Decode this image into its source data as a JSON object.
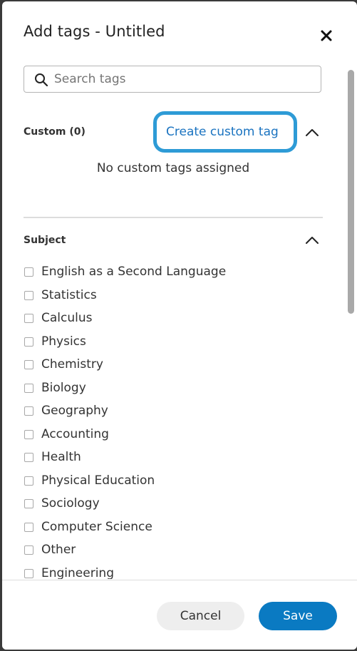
{
  "dialog": {
    "title": "Add tags - Untitled",
    "close_icon": "close-icon"
  },
  "search": {
    "placeholder": "Search tags",
    "value": ""
  },
  "custom": {
    "title": "Custom (0)",
    "create_label": "Create custom tag",
    "empty_text": "No custom tags assigned",
    "expanded": true
  },
  "subject": {
    "title": "Subject",
    "expanded": true,
    "items": [
      {
        "label": "English as a Second Language",
        "checked": false
      },
      {
        "label": "Statistics",
        "checked": false
      },
      {
        "label": "Calculus",
        "checked": false
      },
      {
        "label": "Physics",
        "checked": false
      },
      {
        "label": "Chemistry",
        "checked": false
      },
      {
        "label": "Biology",
        "checked": false
      },
      {
        "label": "Geography",
        "checked": false
      },
      {
        "label": "Accounting",
        "checked": false
      },
      {
        "label": "Health",
        "checked": false
      },
      {
        "label": "Physical Education",
        "checked": false
      },
      {
        "label": "Sociology",
        "checked": false
      },
      {
        "label": "Computer Science",
        "checked": false
      },
      {
        "label": "Other",
        "checked": false
      },
      {
        "label": "Engineering",
        "checked": false
      }
    ]
  },
  "footer": {
    "cancel_label": "Cancel",
    "save_label": "Save"
  },
  "colors": {
    "accent": "#0a7ac2",
    "highlight_ring": "#2e9bd6",
    "link": "#1a73c0"
  }
}
